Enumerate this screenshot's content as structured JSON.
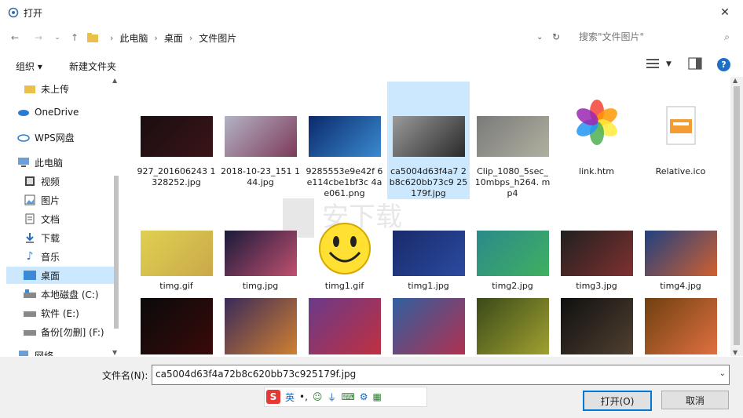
{
  "window": {
    "title": "打开",
    "close_label": "✕"
  },
  "address": {
    "breadcrumb": [
      "此电脑",
      "桌面",
      "文件图片"
    ],
    "search_placeholder": "搜索\"文件图片\""
  },
  "toolbar": {
    "organize": "组织 ▾",
    "new_folder": "新建文件夹"
  },
  "nav": {
    "items": [
      {
        "label": "未上传",
        "icon": "folder-icon"
      },
      {
        "label": "OneDrive",
        "icon": "cloud-icon"
      },
      {
        "label": "WPS网盘",
        "icon": "cloud-icon"
      },
      {
        "label": "此电脑",
        "icon": "computer-icon"
      },
      {
        "label": "视频",
        "icon": "video-icon"
      },
      {
        "label": "图片",
        "icon": "pictures-icon"
      },
      {
        "label": "文档",
        "icon": "document-icon"
      },
      {
        "label": "下载",
        "icon": "download-icon"
      },
      {
        "label": "音乐",
        "icon": "music-icon"
      },
      {
        "label": "桌面",
        "icon": "desktop-icon"
      },
      {
        "label": "本地磁盘 (C:)",
        "icon": "drive-icon"
      },
      {
        "label": "软件 (E:)",
        "icon": "drive-icon"
      },
      {
        "label": "备份[勿删] (F:)",
        "icon": "drive-icon"
      },
      {
        "label": "网络",
        "icon": "network-icon"
      }
    ],
    "selected": "桌面"
  },
  "files": {
    "row1": [
      {
        "name": "927_201606243 1328252.jpg",
        "colors": [
          "#1a0e10",
          "#3a1418"
        ]
      },
      {
        "name": "2018-10-23_151 144.jpg",
        "colors": [
          "#b3b3c5",
          "#7d3a5a"
        ]
      },
      {
        "name": "9285553e9e42f 6e114cbe1bf3c 4ae061.png",
        "colors": [
          "#0a2a6a",
          "#3a8ad0"
        ]
      },
      {
        "name": "ca5004d63f4a7 2b8c620bb73c9 25179f.jpg",
        "colors": [
          "#9a9a9a",
          "#2a2a2a"
        ],
        "selected": true
      },
      {
        "name": "Clip_1080_5sec_ 10mbps_h264. mp4",
        "colors": [
          "#7a7a7a",
          "#b0b0a0"
        ]
      },
      {
        "name": "link.htm",
        "colors": []
      },
      {
        "name": "Relative.ico",
        "colors": []
      }
    ],
    "row2": [
      {
        "name": "timg.gif",
        "colors": [
          "#e0d050",
          "#c9a94a"
        ]
      },
      {
        "name": "timg.jpg",
        "colors": [
          "#1a1a3a",
          "#c05070"
        ]
      },
      {
        "name": "timg1.gif",
        "colors": []
      },
      {
        "name": "timg1.jpg",
        "colors": [
          "#1a2a6a",
          "#2a4aa0"
        ]
      },
      {
        "name": "timg2.jpg",
        "colors": [
          "#2a8a8a",
          "#40b060"
        ]
      },
      {
        "name": "timg3.jpg",
        "colors": [
          "#202020",
          "#803030"
        ]
      },
      {
        "name": "timg4.jpg",
        "colors": [
          "#204080",
          "#d06030"
        ]
      }
    ],
    "row3": [
      {
        "name": "",
        "colors": [
          "#0a0a0a",
          "#3a0a0a"
        ]
      },
      {
        "name": "",
        "colors": [
          "#3a2a5a",
          "#d08030"
        ]
      },
      {
        "name": "",
        "colors": [
          "#6a3a8a",
          "#c03040"
        ]
      },
      {
        "name": "",
        "colors": [
          "#3060a0",
          "#b03050"
        ]
      },
      {
        "name": "",
        "colors": [
          "#3a4a1a",
          "#a0a030"
        ]
      },
      {
        "name": "",
        "colors": [
          "#101010",
          "#504030"
        ]
      },
      {
        "name": "",
        "colors": [
          "#704010",
          "#e07040"
        ]
      }
    ]
  },
  "bottom": {
    "filename_label": "文件名(N):",
    "filename_value": "ca5004d63f4a72b8c620bb73c925179f.jpg",
    "open_label": "打开(O)",
    "cancel_label": "取消",
    "ime_label": "英"
  }
}
